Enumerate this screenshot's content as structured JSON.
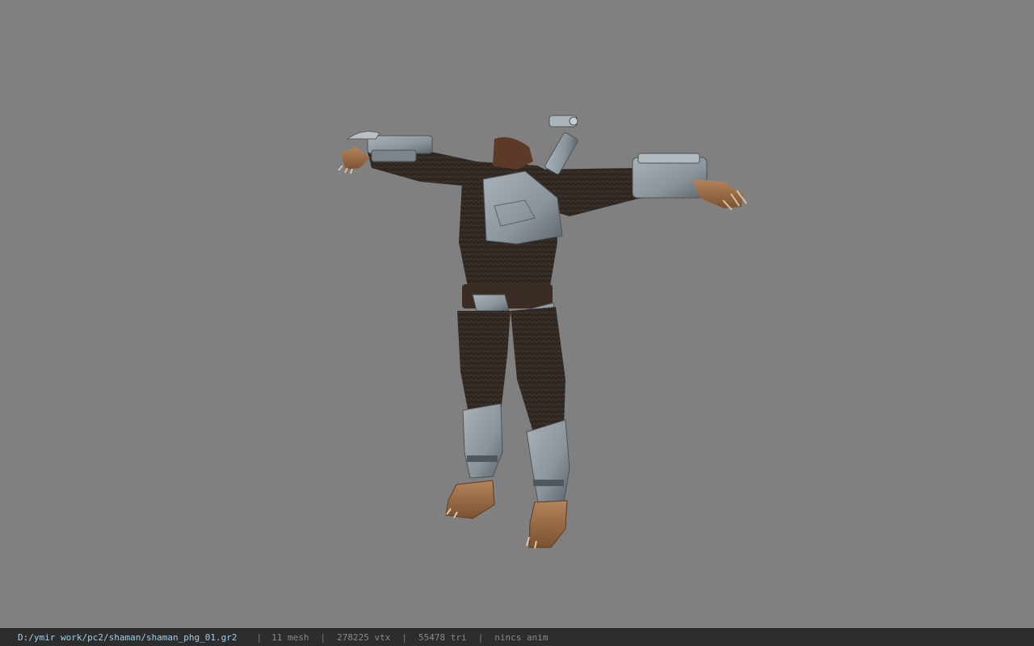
{
  "viewport": {
    "background": "#808080",
    "model": {
      "pose": "t-pose",
      "headless": true,
      "armor_color": "#8a949b",
      "suit_color": "#2e2621",
      "skin_color": "#a0724d"
    }
  },
  "status_bar": {
    "file_path": "D:/ymir work/pc2/shaman/shaman_phg_01.gr2",
    "separator": "|",
    "mesh_count": "11 mesh",
    "vertex_count": "278225 vtx",
    "triangle_count": "55478 tri",
    "animation": "nincs anim"
  }
}
